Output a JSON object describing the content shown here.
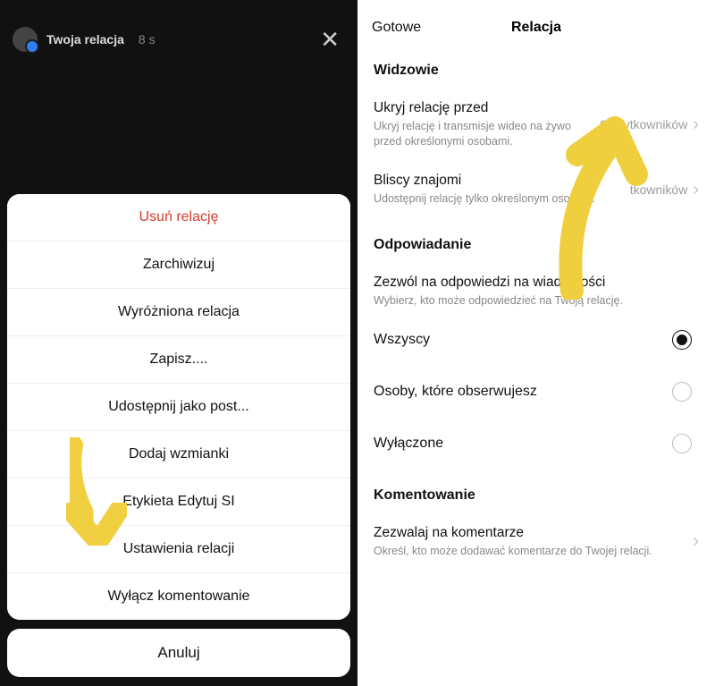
{
  "left": {
    "story_title": "Twoja relacja",
    "story_time": "8 s",
    "sheet": [
      "Usuń relację",
      "Zarchiwizuj",
      "Wyróżniona relacja",
      "Zapisz....",
      "Udostępnij jako post...",
      "Dodaj wzmianki",
      "Etykieta Edytuj SI",
      "Ustawienia relacji",
      "Wyłącz komentowanie"
    ],
    "cancel": "Anuluj"
  },
  "right": {
    "nav_done": "Gotowe",
    "nav_title": "Relacja",
    "section_viewers": "Widzowie",
    "hide_story": {
      "title": "Ukryj relację przed",
      "sub": "Ukryj relację i transmisje wideo na żywo przed określonymi osobami.",
      "value": "0 użytkowników"
    },
    "close_friends": {
      "title": "Bliscy znajomi",
      "sub": "Udostępnij relację tylko określonym osobom.",
      "value": "tkowników"
    },
    "section_reply": "Odpowiadanie",
    "allow_replies": {
      "title": "Zezwól na odpowiedzi na wiadomości",
      "sub": "Wybierz, kto może odpowiedzieć na Twoją relację."
    },
    "reply_options": [
      "Wszyscy",
      "Osoby, które obserwujesz",
      "Wyłączone"
    ],
    "section_comment": "Komentowanie",
    "allow_comments": {
      "title": "Zezwalaj na komentarze",
      "sub": "Określ, kto może dodawać komentarze do Twojej relacji."
    }
  }
}
